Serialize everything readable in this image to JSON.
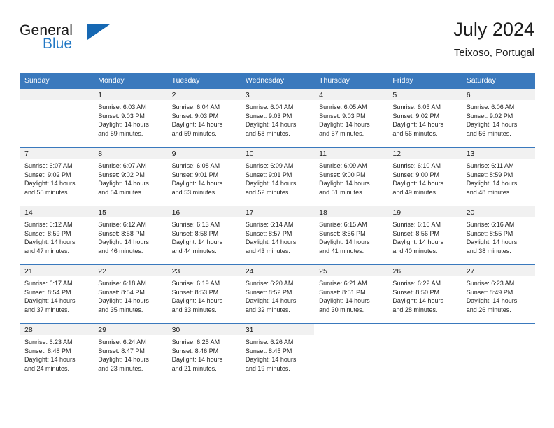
{
  "logo": {
    "word_one": "General",
    "word_two": "Blue",
    "triangle_icon": "triangle-logo-icon",
    "brand_blue": "#1668b3",
    "text_blue": "#2077c4"
  },
  "header": {
    "title": "July 2024",
    "subtitle": "Teixoso, Portugal"
  },
  "theme": {
    "header_bg": "#3a79bd",
    "daynum_bg": "#f1f1f1",
    "border": "#3a79bd"
  },
  "weekdays": [
    "Sunday",
    "Monday",
    "Tuesday",
    "Wednesday",
    "Thursday",
    "Friday",
    "Saturday"
  ],
  "weeks": [
    [
      {
        "day": "",
        "lines": []
      },
      {
        "day": "1",
        "lines": [
          "Sunrise: 6:03 AM",
          "Sunset: 9:03 PM",
          "Daylight: 14 hours",
          "and 59 minutes."
        ]
      },
      {
        "day": "2",
        "lines": [
          "Sunrise: 6:04 AM",
          "Sunset: 9:03 PM",
          "Daylight: 14 hours",
          "and 59 minutes."
        ]
      },
      {
        "day": "3",
        "lines": [
          "Sunrise: 6:04 AM",
          "Sunset: 9:03 PM",
          "Daylight: 14 hours",
          "and 58 minutes."
        ]
      },
      {
        "day": "4",
        "lines": [
          "Sunrise: 6:05 AM",
          "Sunset: 9:03 PM",
          "Daylight: 14 hours",
          "and 57 minutes."
        ]
      },
      {
        "day": "5",
        "lines": [
          "Sunrise: 6:05 AM",
          "Sunset: 9:02 PM",
          "Daylight: 14 hours",
          "and 56 minutes."
        ]
      },
      {
        "day": "6",
        "lines": [
          "Sunrise: 6:06 AM",
          "Sunset: 9:02 PM",
          "Daylight: 14 hours",
          "and 56 minutes."
        ]
      }
    ],
    [
      {
        "day": "7",
        "lines": [
          "Sunrise: 6:07 AM",
          "Sunset: 9:02 PM",
          "Daylight: 14 hours",
          "and 55 minutes."
        ]
      },
      {
        "day": "8",
        "lines": [
          "Sunrise: 6:07 AM",
          "Sunset: 9:02 PM",
          "Daylight: 14 hours",
          "and 54 minutes."
        ]
      },
      {
        "day": "9",
        "lines": [
          "Sunrise: 6:08 AM",
          "Sunset: 9:01 PM",
          "Daylight: 14 hours",
          "and 53 minutes."
        ]
      },
      {
        "day": "10",
        "lines": [
          "Sunrise: 6:09 AM",
          "Sunset: 9:01 PM",
          "Daylight: 14 hours",
          "and 52 minutes."
        ]
      },
      {
        "day": "11",
        "lines": [
          "Sunrise: 6:09 AM",
          "Sunset: 9:00 PM",
          "Daylight: 14 hours",
          "and 51 minutes."
        ]
      },
      {
        "day": "12",
        "lines": [
          "Sunrise: 6:10 AM",
          "Sunset: 9:00 PM",
          "Daylight: 14 hours",
          "and 49 minutes."
        ]
      },
      {
        "day": "13",
        "lines": [
          "Sunrise: 6:11 AM",
          "Sunset: 8:59 PM",
          "Daylight: 14 hours",
          "and 48 minutes."
        ]
      }
    ],
    [
      {
        "day": "14",
        "lines": [
          "Sunrise: 6:12 AM",
          "Sunset: 8:59 PM",
          "Daylight: 14 hours",
          "and 47 minutes."
        ]
      },
      {
        "day": "15",
        "lines": [
          "Sunrise: 6:12 AM",
          "Sunset: 8:58 PM",
          "Daylight: 14 hours",
          "and 46 minutes."
        ]
      },
      {
        "day": "16",
        "lines": [
          "Sunrise: 6:13 AM",
          "Sunset: 8:58 PM",
          "Daylight: 14 hours",
          "and 44 minutes."
        ]
      },
      {
        "day": "17",
        "lines": [
          "Sunrise: 6:14 AM",
          "Sunset: 8:57 PM",
          "Daylight: 14 hours",
          "and 43 minutes."
        ]
      },
      {
        "day": "18",
        "lines": [
          "Sunrise: 6:15 AM",
          "Sunset: 8:56 PM",
          "Daylight: 14 hours",
          "and 41 minutes."
        ]
      },
      {
        "day": "19",
        "lines": [
          "Sunrise: 6:16 AM",
          "Sunset: 8:56 PM",
          "Daylight: 14 hours",
          "and 40 minutes."
        ]
      },
      {
        "day": "20",
        "lines": [
          "Sunrise: 6:16 AM",
          "Sunset: 8:55 PM",
          "Daylight: 14 hours",
          "and 38 minutes."
        ]
      }
    ],
    [
      {
        "day": "21",
        "lines": [
          "Sunrise: 6:17 AM",
          "Sunset: 8:54 PM",
          "Daylight: 14 hours",
          "and 37 minutes."
        ]
      },
      {
        "day": "22",
        "lines": [
          "Sunrise: 6:18 AM",
          "Sunset: 8:54 PM",
          "Daylight: 14 hours",
          "and 35 minutes."
        ]
      },
      {
        "day": "23",
        "lines": [
          "Sunrise: 6:19 AM",
          "Sunset: 8:53 PM",
          "Daylight: 14 hours",
          "and 33 minutes."
        ]
      },
      {
        "day": "24",
        "lines": [
          "Sunrise: 6:20 AM",
          "Sunset: 8:52 PM",
          "Daylight: 14 hours",
          "and 32 minutes."
        ]
      },
      {
        "day": "25",
        "lines": [
          "Sunrise: 6:21 AM",
          "Sunset: 8:51 PM",
          "Daylight: 14 hours",
          "and 30 minutes."
        ]
      },
      {
        "day": "26",
        "lines": [
          "Sunrise: 6:22 AM",
          "Sunset: 8:50 PM",
          "Daylight: 14 hours",
          "and 28 minutes."
        ]
      },
      {
        "day": "27",
        "lines": [
          "Sunrise: 6:23 AM",
          "Sunset: 8:49 PM",
          "Daylight: 14 hours",
          "and 26 minutes."
        ]
      }
    ],
    [
      {
        "day": "28",
        "lines": [
          "Sunrise: 6:23 AM",
          "Sunset: 8:48 PM",
          "Daylight: 14 hours",
          "and 24 minutes."
        ]
      },
      {
        "day": "29",
        "lines": [
          "Sunrise: 6:24 AM",
          "Sunset: 8:47 PM",
          "Daylight: 14 hours",
          "and 23 minutes."
        ]
      },
      {
        "day": "30",
        "lines": [
          "Sunrise: 6:25 AM",
          "Sunset: 8:46 PM",
          "Daylight: 14 hours",
          "and 21 minutes."
        ]
      },
      {
        "day": "31",
        "lines": [
          "Sunrise: 6:26 AM",
          "Sunset: 8:45 PM",
          "Daylight: 14 hours",
          "and 19 minutes."
        ]
      },
      {
        "day": "",
        "lines": []
      },
      {
        "day": "",
        "lines": []
      },
      {
        "day": "",
        "lines": []
      }
    ]
  ]
}
